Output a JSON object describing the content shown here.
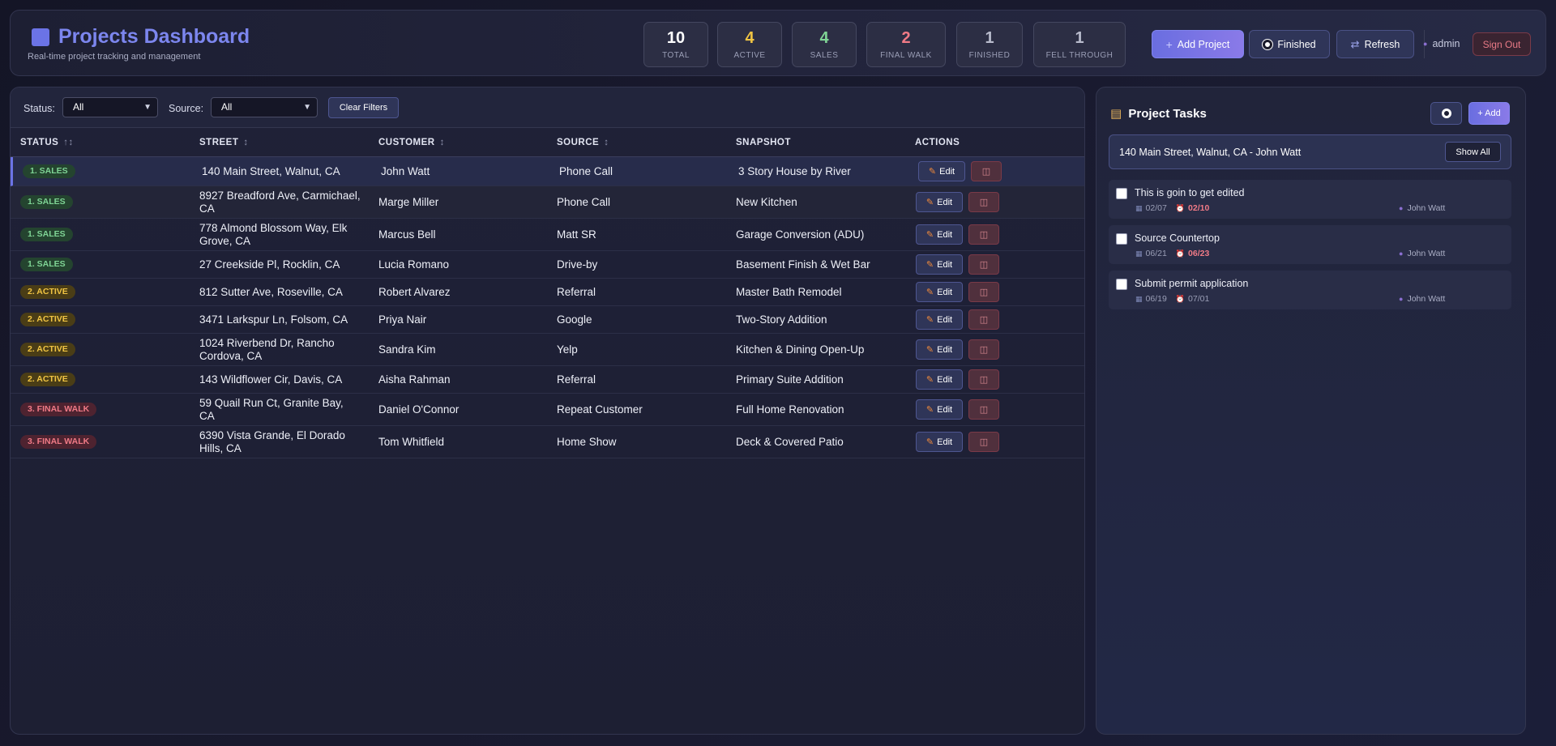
{
  "header": {
    "title": "Projects Dashboard",
    "subtitle": "Real-time project tracking and management",
    "accent_color": "#7c86ee",
    "stats": [
      {
        "value": "10",
        "label": "TOTAL",
        "color": "#ffffff"
      },
      {
        "value": "4",
        "label": "ACTIVE",
        "color": "#f0c443"
      },
      {
        "value": "4",
        "label": "SALES",
        "color": "#7fd495"
      },
      {
        "value": "2",
        "label": "FINAL WALK",
        "color": "#f07a86"
      },
      {
        "value": "1",
        "label": "FINISHED",
        "color": "#b8bbcc"
      },
      {
        "value": "1",
        "label": "FELL THROUGH",
        "color": "#b8bbcc"
      }
    ],
    "add_project_label": "Add Project",
    "finished_label": "Finished",
    "refresh_label": "Refresh",
    "user": "admin",
    "sign_out_label": "Sign Out"
  },
  "filters": {
    "status_label": "Status:",
    "status_value": "All",
    "source_label": "Source:",
    "source_value": "All",
    "clear_label": "Clear Filters"
  },
  "table": {
    "columns": [
      "STATUS",
      "STREET",
      "CUSTOMER",
      "SOURCE",
      "SNAPSHOT",
      "ACTIONS"
    ],
    "edit_label": "Edit",
    "rows": [
      {
        "status": "1. SALES",
        "street": "140 Main Street, Walnut, CA",
        "customer": "John Watt",
        "source": "Phone Call",
        "snapshot": "3 Story House by River"
      },
      {
        "status": "1. SALES",
        "street": "8927 Breadford Ave, Carmichael, CA",
        "customer": "Marge Miller",
        "source": "Phone Call",
        "snapshot": "New Kitchen"
      },
      {
        "status": "1. SALES",
        "street": "778 Almond Blossom Way, Elk Grove, CA",
        "customer": "Marcus Bell",
        "source": "Matt SR",
        "snapshot": "Garage Conversion (ADU)"
      },
      {
        "status": "1. SALES",
        "street": "27 Creekside Pl, Rocklin, CA",
        "customer": "Lucia Romano",
        "source": "Drive-by",
        "snapshot": "Basement Finish & Wet Bar"
      },
      {
        "status": "2. ACTIVE",
        "street": "812 Sutter Ave, Roseville, CA",
        "customer": "Robert Alvarez",
        "source": "Referral",
        "snapshot": "Master Bath Remodel"
      },
      {
        "status": "2. ACTIVE",
        "street": "3471 Larkspur Ln, Folsom, CA",
        "customer": "Priya Nair",
        "source": "Google",
        "snapshot": "Two-Story Addition"
      },
      {
        "status": "2. ACTIVE",
        "street": "1024 Riverbend Dr, Rancho Cordova, CA",
        "customer": "Sandra Kim",
        "source": "Yelp",
        "snapshot": "Kitchen & Dining Open-Up"
      },
      {
        "status": "2. ACTIVE",
        "street": "143 Wildflower Cir, Davis, CA",
        "customer": "Aisha Rahman",
        "source": "Referral",
        "snapshot": "Primary Suite Addition"
      },
      {
        "status": "3. FINAL WALK",
        "street": "59 Quail Run Ct, Granite Bay, CA",
        "customer": "Daniel O'Connor",
        "source": "Repeat Customer",
        "snapshot": "Full Home Renovation"
      },
      {
        "status": "3. FINAL WALK",
        "street": "6390 Vista Grande, El Dorado Hills, CA",
        "customer": "Tom Whitfield",
        "source": "Home Show",
        "snapshot": "Deck & Covered Patio"
      }
    ]
  },
  "tasks": {
    "title": "Project Tasks",
    "add_label": "+ Add",
    "project_label": "140 Main Street, Walnut, CA - John Watt",
    "show_all_label": "Show All",
    "items": [
      {
        "name": "This is goin to get edited",
        "start": "02/07",
        "due": "02/10",
        "due_overdue": true,
        "assignee": "John Watt"
      },
      {
        "name": "Source Countertop",
        "start": "06/21",
        "due": "06/23",
        "due_overdue": true,
        "assignee": "John Watt"
      },
      {
        "name": "Submit permit application",
        "start": "06/19",
        "due": "07/01",
        "due_overdue": false,
        "assignee": "John Watt"
      }
    ]
  }
}
